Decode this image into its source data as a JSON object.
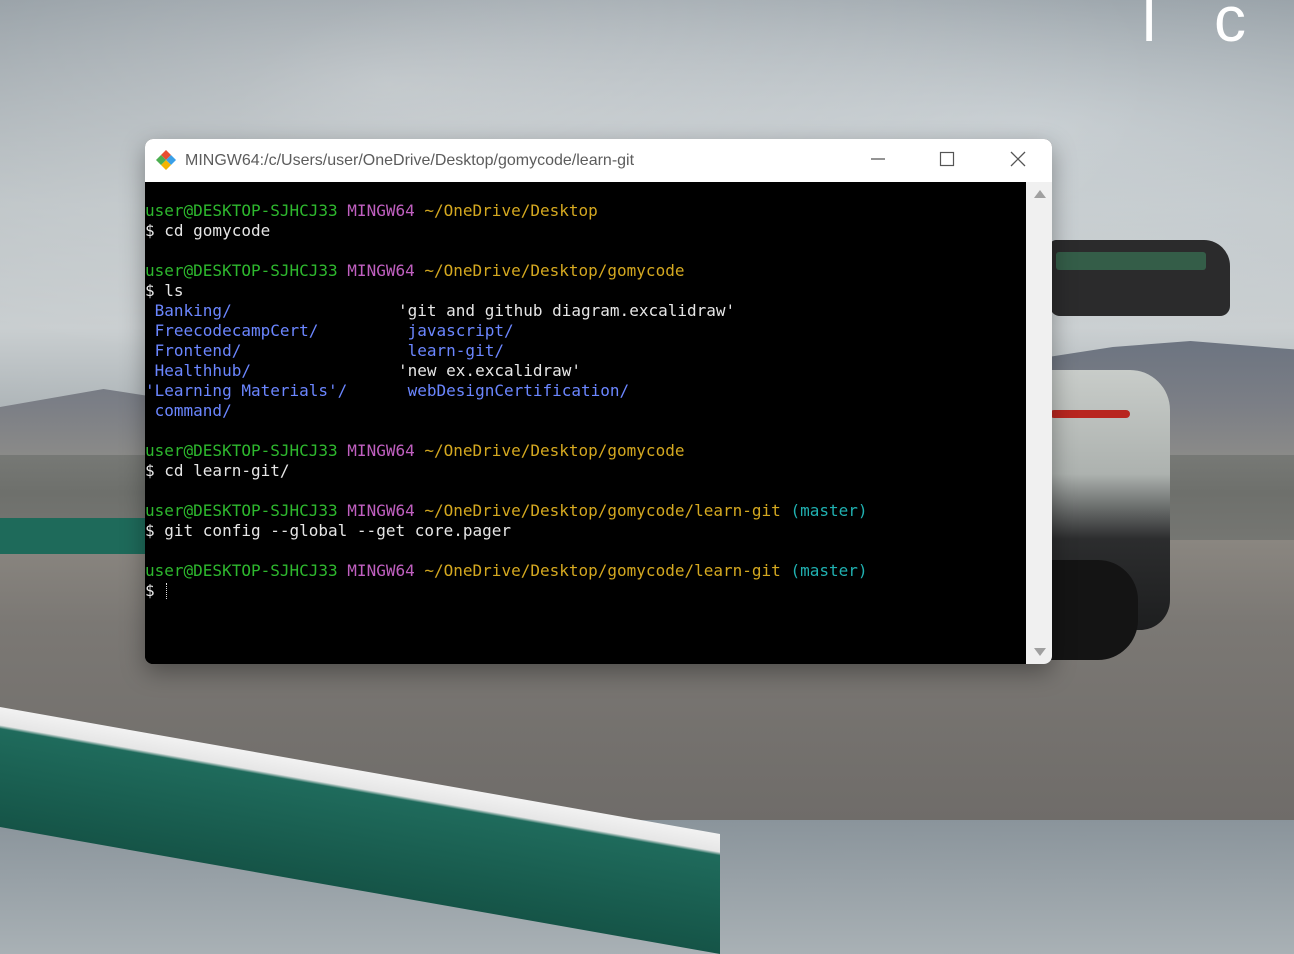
{
  "desktop": {
    "corner_text": "l c"
  },
  "window": {
    "title": "MINGW64:/c/Users/user/OneDrive/Desktop/gomycode/learn-git",
    "icons": {
      "app": "git-bash-icon",
      "minimize": "minimize-icon",
      "maximize": "maximize-icon",
      "close": "close-icon"
    }
  },
  "colors": {
    "user_host": "#2eb82e",
    "shell": "#c060c0",
    "path": "#d4a820",
    "branch": "#20b0b0",
    "directory": "#6b86ff",
    "text": "#e6e6e6"
  },
  "terminal": {
    "prompt1": {
      "user": "user@DESKTOP-SJHCJ33",
      "shell": "MINGW64",
      "path": "~/OneDrive/Desktop",
      "branch": ""
    },
    "cmd1": "$ cd gomycode",
    "prompt2": {
      "user": "user@DESKTOP-SJHCJ33",
      "shell": "MINGW64",
      "path": "~/OneDrive/Desktop/gomycode",
      "branch": ""
    },
    "cmd2": "$ ls",
    "ls": [
      {
        "left": " Banking/",
        "right": "'git and github diagram.excalidraw'",
        "right_is_dir": false
      },
      {
        "left": " FreecodecampCert/",
        "right": " javascript/",
        "right_is_dir": true
      },
      {
        "left": " Frontend/",
        "right": " learn-git/",
        "right_is_dir": true
      },
      {
        "left": " Healthhub/",
        "right": "'new ex.excalidraw'",
        "right_is_dir": false
      },
      {
        "left": "'Learning Materials'/",
        "right": " webDesignCertification/",
        "right_is_dir": true
      },
      {
        "left": " command/",
        "right": "",
        "right_is_dir": false
      }
    ],
    "prompt3": {
      "user": "user@DESKTOP-SJHCJ33",
      "shell": "MINGW64",
      "path": "~/OneDrive/Desktop/gomycode",
      "branch": ""
    },
    "cmd3": "$ cd learn-git/",
    "prompt4": {
      "user": "user@DESKTOP-SJHCJ33",
      "shell": "MINGW64",
      "path": "~/OneDrive/Desktop/gomycode/learn-git",
      "branch": "(master)"
    },
    "cmd4": "$ git config --global --get core.pager",
    "prompt5": {
      "user": "user@DESKTOP-SJHCJ33",
      "shell": "MINGW64",
      "path": "~/OneDrive/Desktop/gomycode/learn-git",
      "branch": "(master)"
    },
    "cmd5": "$ "
  }
}
